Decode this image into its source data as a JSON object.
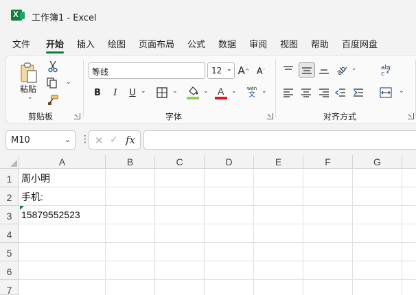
{
  "window": {
    "title": "工作簿1  -  Excel",
    "accent": "#107c41"
  },
  "tabs": [
    "文件",
    "开始",
    "插入",
    "绘图",
    "页面布局",
    "公式",
    "数据",
    "审阅",
    "视图",
    "帮助",
    "百度网盘"
  ],
  "active_tab": "开始",
  "ribbon": {
    "clipboard": {
      "paste_label": "粘贴",
      "group_label": "剪贴板"
    },
    "font": {
      "font_name": "等线",
      "font_size": "12",
      "group_label": "字体",
      "bold": "B",
      "italic": "I",
      "underline": "U",
      "phonetic_top": "wén",
      "phonetic_bottom": "文",
      "fill_color": "#92d050",
      "font_color": "#e81123"
    },
    "alignment": {
      "group_label": "对齐方式"
    }
  },
  "formula_bar": {
    "name_box": "M10",
    "formula": ""
  },
  "sheet": {
    "columns": [
      "A",
      "B",
      "C",
      "D",
      "E",
      "F",
      "G"
    ],
    "rows": [
      "1",
      "2",
      "3",
      "4",
      "5",
      "6",
      "7"
    ],
    "cells": {
      "A1": "周小明",
      "A2": "手机:",
      "A3": "15879552523"
    }
  }
}
